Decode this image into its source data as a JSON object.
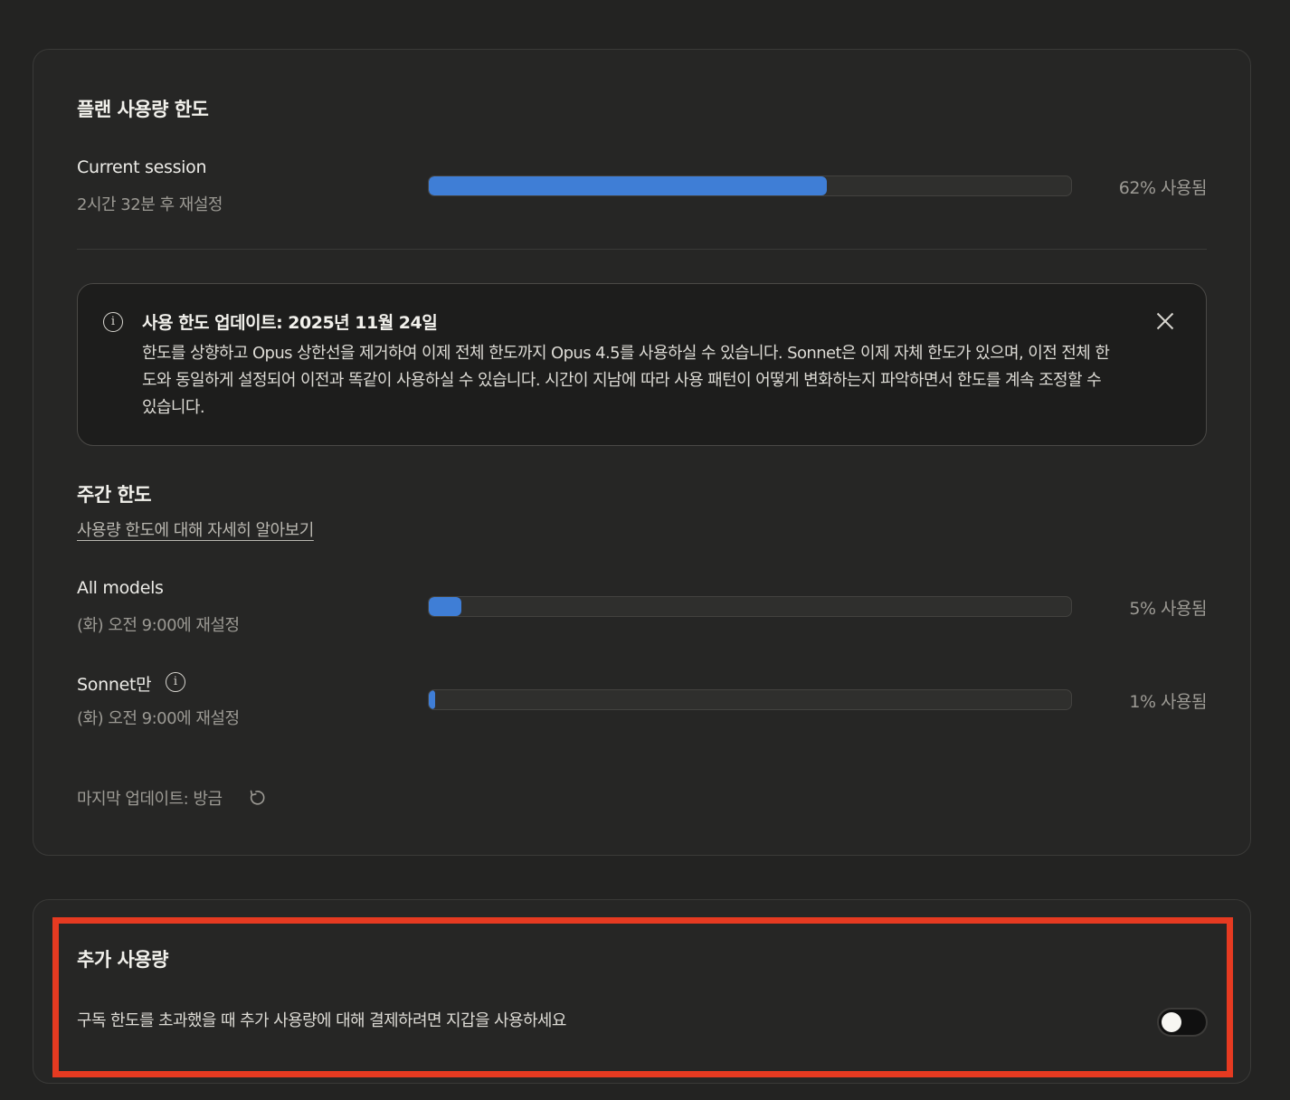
{
  "plan_limits": {
    "heading": "플랜 사용량 한도",
    "current_session": {
      "label": "Current session",
      "reset": "2시간 32분 후 재설정",
      "percent": 62,
      "usage_text": "62% 사용됨"
    }
  },
  "notice": {
    "title": "사용 한도 업데이트: 2025년 11월 24일",
    "body": "한도를 상향하고 Opus 상한선을 제거하여 이제 전체 한도까지 Opus 4.5를 사용하실 수 있습니다. Sonnet은 이제 자체 한도가 있으며, 이전 전체 한도와 동일하게 설정되어 이전과 똑같이 사용하실 수 있습니다. 시간이 지남에 따라 사용 패턴이 어떻게 변화하는지 파악하면서 한도를 계속 조정할 수 있습니다.",
    "info_icon": "info-icon",
    "close_icon": "close-icon"
  },
  "weekly": {
    "heading": "주간 한도",
    "learn_more": "사용량 한도에 대해 자세히 알아보기",
    "all_models": {
      "label": "All models",
      "reset": "(화) 오전 9:00에 재설정",
      "percent": 5,
      "usage_text": "5% 사용됨"
    },
    "sonnet": {
      "label": "Sonnet만",
      "reset": "(화) 오전 9:00에 재설정",
      "percent": 1,
      "usage_text": "1% 사용됨"
    },
    "last_updated": "마지막 업데이트: 방금"
  },
  "extra_usage": {
    "heading": "추가 사용량",
    "description": "구독 한도를 초과했을 때 추가 사용량에 대해 결제하려면 지갑을 사용하세요",
    "toggle_on": false
  },
  "colors": {
    "background": "#232322",
    "accent": "#3f7ed6",
    "highlight": "#e53a21"
  }
}
